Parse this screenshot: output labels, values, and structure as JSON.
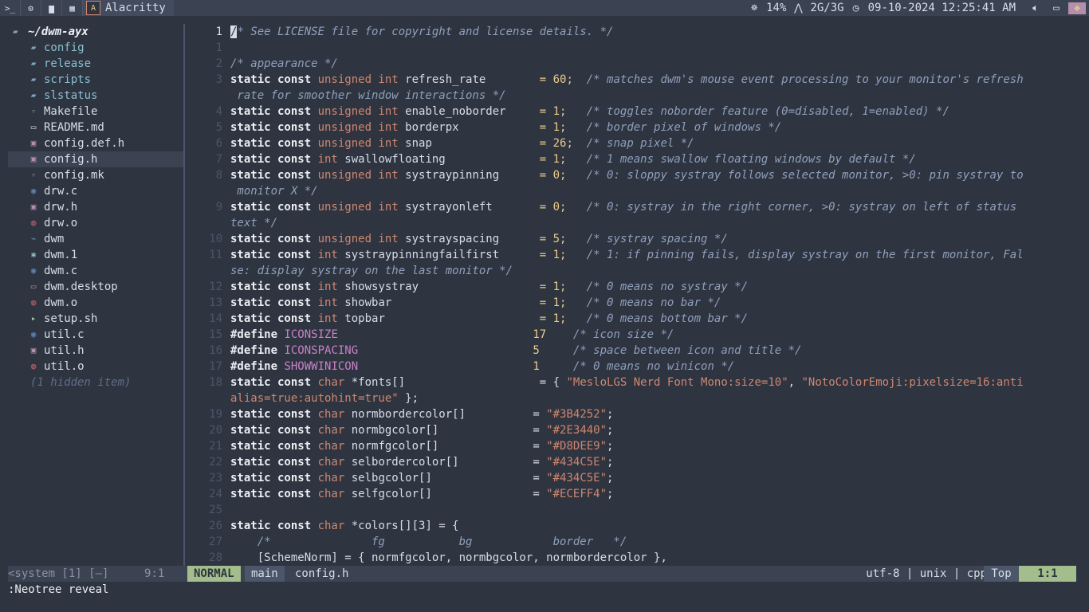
{
  "topbar": {
    "window_title": "Alacritty",
    "cpu": "14%",
    "network": "2G/3G",
    "datetime": "09-10-2024 12:25:41 AM"
  },
  "tree": {
    "root": "~/dwm-ayx",
    "items": [
      {
        "name": "config",
        "kind": "dir",
        "icon": "folder-icon",
        "color": "#81a1c1"
      },
      {
        "name": "release",
        "kind": "dir",
        "icon": "folder-icon",
        "color": "#81a1c1"
      },
      {
        "name": "scripts",
        "kind": "dir",
        "icon": "folder-icon",
        "color": "#81a1c1"
      },
      {
        "name": "slstatus",
        "kind": "dir",
        "icon": "folder-icon",
        "color": "#81a1c1"
      },
      {
        "name": "Makefile",
        "kind": "file",
        "icon": "makefile-icon",
        "color": "#6d7686"
      },
      {
        "name": "README.md",
        "kind": "file",
        "icon": "markdown-icon",
        "color": "#d8dee9"
      },
      {
        "name": "config.def.h",
        "kind": "file",
        "icon": "header-icon",
        "color": "#b48ead"
      },
      {
        "name": "config.h",
        "kind": "file",
        "icon": "header-icon",
        "color": "#b48ead"
      },
      {
        "name": "config.mk",
        "kind": "file",
        "icon": "makefile-icon",
        "color": "#6d7686"
      },
      {
        "name": "drw.c",
        "kind": "file",
        "icon": "c-file-icon",
        "color": "#5e81ac"
      },
      {
        "name": "drw.h",
        "kind": "file",
        "icon": "header-icon",
        "color": "#b48ead"
      },
      {
        "name": "drw.o",
        "kind": "file",
        "icon": "object-file-icon",
        "color": "#bf616a"
      },
      {
        "name": "dwm",
        "kind": "file",
        "icon": "binary-icon",
        "color": "#5e81ac"
      },
      {
        "name": "dwm.1",
        "kind": "file",
        "icon": "manpage-icon",
        "color": "#88c0d0"
      },
      {
        "name": "dwm.c",
        "kind": "file",
        "icon": "c-file-icon",
        "color": "#5e81ac"
      },
      {
        "name": "dwm.desktop",
        "kind": "file",
        "icon": "desktop-file-icon",
        "color": "#b48ead"
      },
      {
        "name": "dwm.o",
        "kind": "file",
        "icon": "object-file-icon",
        "color": "#bf616a"
      },
      {
        "name": "setup.sh",
        "kind": "file",
        "icon": "shell-script-icon",
        "color": "#a3be8c"
      },
      {
        "name": "util.c",
        "kind": "file",
        "icon": "c-file-icon",
        "color": "#5e81ac"
      },
      {
        "name": "util.h",
        "kind": "file",
        "icon": "header-icon",
        "color": "#b48ead"
      },
      {
        "name": "util.o",
        "kind": "file",
        "icon": "object-file-icon",
        "color": "#bf616a"
      }
    ],
    "hidden": "(1 hidden item)",
    "status_label": "<system [1] [–]",
    "status_pos": "9:1"
  },
  "editor": {
    "lines": [
      {
        "n": "1",
        "cur": true,
        "segs": [
          [
            "cursor",
            "/"
          ],
          [
            "cm",
            "* See LICENSE file for copyright and license details. */"
          ]
        ]
      },
      {
        "n": "1",
        "segs": []
      },
      {
        "n": "2",
        "segs": [
          [
            "cm",
            "/* appearance */"
          ]
        ]
      },
      {
        "n": "3",
        "segs": [
          [
            "kw",
            "static const "
          ],
          [
            "ty",
            "unsigned int "
          ],
          [
            "nb",
            "refresh_rate        "
          ],
          [
            "st",
            "= 60;  "
          ],
          [
            "cm",
            "/* matches dwm's mouse event processing to your monitor's refresh"
          ]
        ]
      },
      {
        "n": "",
        "segs": [
          [
            "cm",
            " rate for smoother window interactions */"
          ]
        ]
      },
      {
        "n": "4",
        "segs": [
          [
            "kw",
            "static const "
          ],
          [
            "ty",
            "unsigned int "
          ],
          [
            "nb",
            "enable_noborder     "
          ],
          [
            "st",
            "= 1;   "
          ],
          [
            "cm",
            "/* toggles noborder feature (0=disabled, 1=enabled) */"
          ]
        ]
      },
      {
        "n": "5",
        "segs": [
          [
            "kw",
            "static const "
          ],
          [
            "ty",
            "unsigned int "
          ],
          [
            "nb",
            "borderpx            "
          ],
          [
            "st",
            "= 1;   "
          ],
          [
            "cm",
            "/* border pixel of windows */"
          ]
        ]
      },
      {
        "n": "6",
        "segs": [
          [
            "kw",
            "static const "
          ],
          [
            "ty",
            "unsigned int "
          ],
          [
            "nb",
            "snap                "
          ],
          [
            "st",
            "= 26;  "
          ],
          [
            "cm",
            "/* snap pixel */"
          ]
        ]
      },
      {
        "n": "7",
        "segs": [
          [
            "kw",
            "static const "
          ],
          [
            "ty",
            "int "
          ],
          [
            "nb",
            "swallowfloating              "
          ],
          [
            "st",
            "= 1;   "
          ],
          [
            "cm",
            "/* 1 means swallow floating windows by default */"
          ]
        ]
      },
      {
        "n": "8",
        "segs": [
          [
            "kw",
            "static const "
          ],
          [
            "ty",
            "unsigned int "
          ],
          [
            "nb",
            "systraypinning      "
          ],
          [
            "st",
            "= 0;   "
          ],
          [
            "cm",
            "/* 0: sloppy systray follows selected monitor, >0: pin systray to"
          ]
        ]
      },
      {
        "n": "",
        "segs": [
          [
            "cm",
            " monitor X */"
          ]
        ]
      },
      {
        "n": "9",
        "segs": [
          [
            "kw",
            "static const "
          ],
          [
            "ty",
            "unsigned int "
          ],
          [
            "nb",
            "systrayonleft       "
          ],
          [
            "st",
            "= 0;   "
          ],
          [
            "cm",
            "/* 0: systray in the right corner, >0: systray on left of status"
          ]
        ]
      },
      {
        "n": "",
        "segs": [
          [
            "cm",
            "text */"
          ]
        ]
      },
      {
        "n": "10",
        "segs": [
          [
            "kw",
            "static const "
          ],
          [
            "ty",
            "unsigned int "
          ],
          [
            "nb",
            "systrayspacing      "
          ],
          [
            "st",
            "= 5;   "
          ],
          [
            "cm",
            "/* systray spacing */"
          ]
        ]
      },
      {
        "n": "11",
        "segs": [
          [
            "kw",
            "static const "
          ],
          [
            "ty",
            "int "
          ],
          [
            "nb",
            "systraypinningfailfirst      "
          ],
          [
            "st",
            "= 1;   "
          ],
          [
            "cm",
            "/* 1: if pinning fails, display systray on the first monitor, Fal"
          ]
        ]
      },
      {
        "n": "",
        "segs": [
          [
            "cm",
            "se: display systray on the last monitor */"
          ]
        ]
      },
      {
        "n": "12",
        "segs": [
          [
            "kw",
            "static const "
          ],
          [
            "ty",
            "int "
          ],
          [
            "nb",
            "showsystray                  "
          ],
          [
            "st",
            "= 1;   "
          ],
          [
            "cm",
            "/* 0 means no systray */"
          ]
        ]
      },
      {
        "n": "13",
        "segs": [
          [
            "kw",
            "static const "
          ],
          [
            "ty",
            "int "
          ],
          [
            "nb",
            "showbar                      "
          ],
          [
            "st",
            "= 1;   "
          ],
          [
            "cm",
            "/* 0 means no bar */"
          ]
        ]
      },
      {
        "n": "14",
        "segs": [
          [
            "kw",
            "static const "
          ],
          [
            "ty",
            "int "
          ],
          [
            "nb",
            "topbar                       "
          ],
          [
            "st",
            "= 1;   "
          ],
          [
            "cm",
            "/* 0 means bottom bar */"
          ]
        ]
      },
      {
        "n": "15",
        "segs": [
          [
            "kw",
            "#define "
          ],
          [
            "mc",
            "ICONSIZE                             "
          ],
          [
            "st",
            "17    "
          ],
          [
            "cm",
            "/* icon size */"
          ]
        ]
      },
      {
        "n": "16",
        "segs": [
          [
            "kw",
            "#define "
          ],
          [
            "mc",
            "ICONSPACING                          "
          ],
          [
            "st",
            "5     "
          ],
          [
            "cm",
            "/* space between icon and title */"
          ]
        ]
      },
      {
        "n": "17",
        "segs": [
          [
            "kw",
            "#define "
          ],
          [
            "mc",
            "SHOWWINICON                          "
          ],
          [
            "st",
            "1     "
          ],
          [
            "cm",
            "/* 0 means no winicon */"
          ]
        ]
      },
      {
        "n": "18",
        "segs": [
          [
            "kw",
            "static const "
          ],
          [
            "ty",
            "char "
          ],
          [
            "nb",
            "*fonts[]                    "
          ],
          [
            "nb",
            "= { "
          ],
          [
            "ty",
            "\"MesloLGS Nerd Font Mono:size=10\""
          ],
          [
            "nb",
            ", "
          ],
          [
            "ty",
            "\"NotoColorEmoji:pixelsize=16:anti"
          ]
        ]
      },
      {
        "n": "",
        "segs": [
          [
            "ty",
            "alias=true:autohint=true\""
          ],
          [
            "nb",
            " };"
          ]
        ]
      },
      {
        "n": "19",
        "segs": [
          [
            "kw",
            "static const "
          ],
          [
            "ty",
            "char "
          ],
          [
            "nb",
            "normbordercolor[]          "
          ],
          [
            "nb",
            "= "
          ],
          [
            "ty",
            "\"#3B4252\""
          ],
          [
            "nb",
            ";"
          ]
        ]
      },
      {
        "n": "20",
        "segs": [
          [
            "kw",
            "static const "
          ],
          [
            "ty",
            "char "
          ],
          [
            "nb",
            "normbgcolor[]              "
          ],
          [
            "nb",
            "= "
          ],
          [
            "ty",
            "\"#2E3440\""
          ],
          [
            "nb",
            ";"
          ]
        ]
      },
      {
        "n": "21",
        "segs": [
          [
            "kw",
            "static const "
          ],
          [
            "ty",
            "char "
          ],
          [
            "nb",
            "normfgcolor[]              "
          ],
          [
            "nb",
            "= "
          ],
          [
            "ty",
            "\"#D8DEE9\""
          ],
          [
            "nb",
            ";"
          ]
        ]
      },
      {
        "n": "22",
        "segs": [
          [
            "kw",
            "static const "
          ],
          [
            "ty",
            "char "
          ],
          [
            "nb",
            "selbordercolor[]           "
          ],
          [
            "nb",
            "= "
          ],
          [
            "ty",
            "\"#434C5E\""
          ],
          [
            "nb",
            ";"
          ]
        ]
      },
      {
        "n": "23",
        "segs": [
          [
            "kw",
            "static const "
          ],
          [
            "ty",
            "char "
          ],
          [
            "nb",
            "selbgcolor[]               "
          ],
          [
            "nb",
            "= "
          ],
          [
            "ty",
            "\"#434C5E\""
          ],
          [
            "nb",
            ";"
          ]
        ]
      },
      {
        "n": "24",
        "segs": [
          [
            "kw",
            "static const "
          ],
          [
            "ty",
            "char "
          ],
          [
            "nb",
            "selfgcolor[]               "
          ],
          [
            "nb",
            "= "
          ],
          [
            "ty",
            "\"#ECEFF4\""
          ],
          [
            "nb",
            ";"
          ]
        ]
      },
      {
        "n": "25",
        "segs": []
      },
      {
        "n": "26",
        "segs": [
          [
            "kw",
            "static const "
          ],
          [
            "ty",
            "char "
          ],
          [
            "nb",
            "*colors[][3] = {"
          ]
        ]
      },
      {
        "n": "27",
        "segs": [
          [
            "cm",
            "    /*               fg           bg            border   */"
          ]
        ]
      },
      {
        "n": "28",
        "segs": [
          [
            "nb",
            "    [SchemeNorm] = { normfgcolor, normbgcolor, normbordercolor },"
          ]
        ]
      }
    ]
  },
  "statusline": {
    "mode": "NORMAL",
    "branch": "main",
    "file": "config.h",
    "encoding": "utf-8 | unix | cpp",
    "scroll": "Top",
    "position": "1:1"
  },
  "cmdline": ":Neotree reveal"
}
